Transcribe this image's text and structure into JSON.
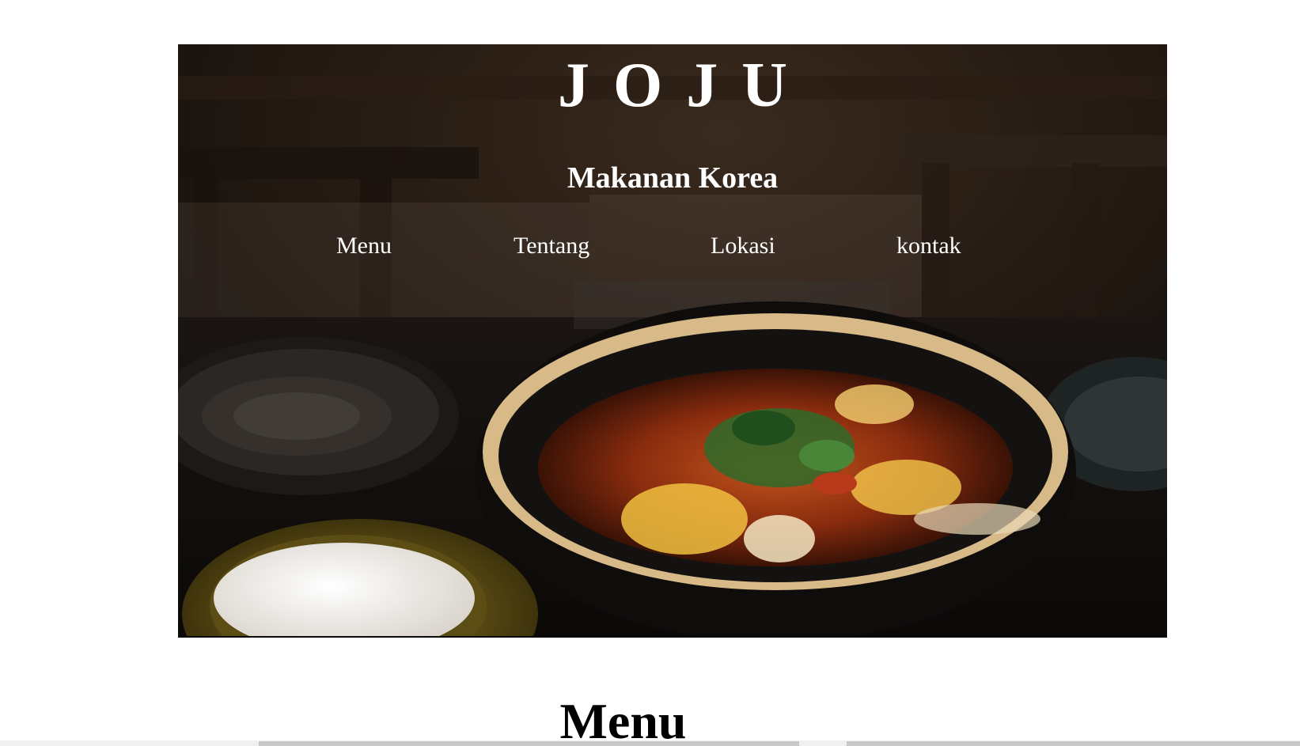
{
  "header": {
    "brand": "JOJU",
    "subtitle": "Makanan Korea"
  },
  "nav": {
    "items": [
      {
        "label": "Menu"
      },
      {
        "label": "Tentang"
      },
      {
        "label": "Lokasi"
      },
      {
        "label": "kontak"
      }
    ]
  },
  "sections": {
    "menu_title": "Menu"
  },
  "hero_image": {
    "subject": "korean-soup-bowl-with-rice"
  },
  "colors": {
    "text_on_hero": "#ffffff",
    "page_background": "#ffffff"
  }
}
